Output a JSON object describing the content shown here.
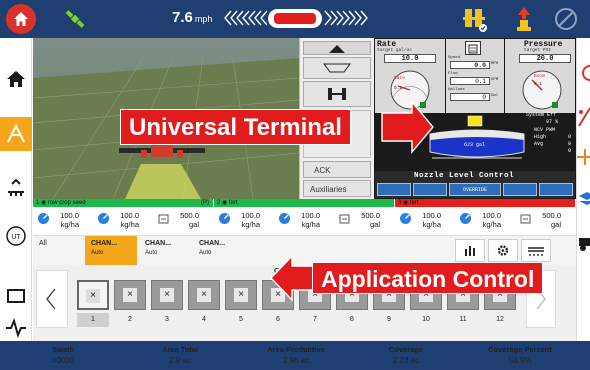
{
  "topbar": {
    "speed_value": "7.6",
    "speed_unit": "mph"
  },
  "vt": {
    "rate_title": "Rate",
    "rate_sub": "target  gal/ac",
    "rate_value": "10.0",
    "speed_label": "Speed",
    "speed_value": "0.0",
    "speed_unit": "MPH",
    "flow_label": "Flow",
    "flow_value": "0.1",
    "flow_unit": "GPM",
    "gallons_label": "Gallons",
    "gallons_value": "0",
    "gallons_unit": "Gal",
    "gauge_rate_text": "Rate",
    "gauge_rate_value": "0.1",
    "gauge_boom_text": "Boom",
    "gauge_boom_value": "0.1",
    "pressure_title": "Pressure",
    "pressure_sub": "target  PSI",
    "pressure_value": "20.0",
    "system_eff_label": "System Eff",
    "system_eff_value": "97 %",
    "ncv_label": "NCV PWM",
    "high_label": "High",
    "high_value": "0",
    "avg_label": "Avg",
    "avg_value": "0",
    "low_value": "0",
    "tank_value": "623 gal",
    "nozzle_title": "Nozzle Level Control",
    "override_label": "OVERRIDE"
  },
  "mid_panel": {
    "ack_label": "ACK",
    "aux_label": "Auxiliaries"
  },
  "channels": [
    {
      "num": "1",
      "name": "row crop seed",
      "suffix": "(P)",
      "color": "#1db84a",
      "vals": [
        {
          "v": "100.0",
          "u": "kg/ha"
        },
        {
          "v": "100.0",
          "u": "kg/ha"
        },
        {
          "v": "500.0",
          "u": "gal"
        }
      ]
    },
    {
      "num": "2",
      "name": "fert",
      "suffix": "",
      "color": "#1db84a",
      "vals": [
        {
          "v": "100.0",
          "u": "kg/ha"
        },
        {
          "v": "100.0",
          "u": "kg/ha"
        },
        {
          "v": "500.0",
          "u": "gal"
        }
      ]
    },
    {
      "num": "3",
      "name": "fert",
      "suffix": "",
      "color": "#e5201c",
      "vals": [
        {
          "v": "100.0",
          "u": "kg/ha"
        },
        {
          "v": "100.0",
          "u": "kg/ha"
        },
        {
          "v": "500.0",
          "u": "gal"
        }
      ]
    }
  ],
  "tabs": [
    {
      "label": "All",
      "sub": ""
    },
    {
      "label": "CHAN...",
      "sub": "Auto"
    },
    {
      "label": "CHAN...",
      "sub": "Auto"
    },
    {
      "label": "CHAN...",
      "sub": "Auto"
    }
  ],
  "section": {
    "title": "CHAN",
    "numbers": [
      "1",
      "2",
      "3",
      "4",
      "5",
      "6",
      "7",
      "8",
      "9",
      "10",
      "11",
      "12"
    ]
  },
  "status": [
    {
      "label": "Swath",
      "value": "#0000"
    },
    {
      "label": "Area Total",
      "value": "2.9 ac"
    },
    {
      "label": "Area Productive",
      "value": "2.96 ac"
    },
    {
      "label": "Coverage",
      "value": "2.23 ac"
    },
    {
      "label": "Coverage Percent",
      "value": "53.9%"
    }
  ],
  "callouts": {
    "universal_terminal": "Universal Terminal",
    "application_control": "Application Control"
  },
  "colors": {
    "topbar": "#1f3f73",
    "accent": "#f4a71b",
    "home": "#d8322c",
    "callout": "#e21c1c"
  }
}
